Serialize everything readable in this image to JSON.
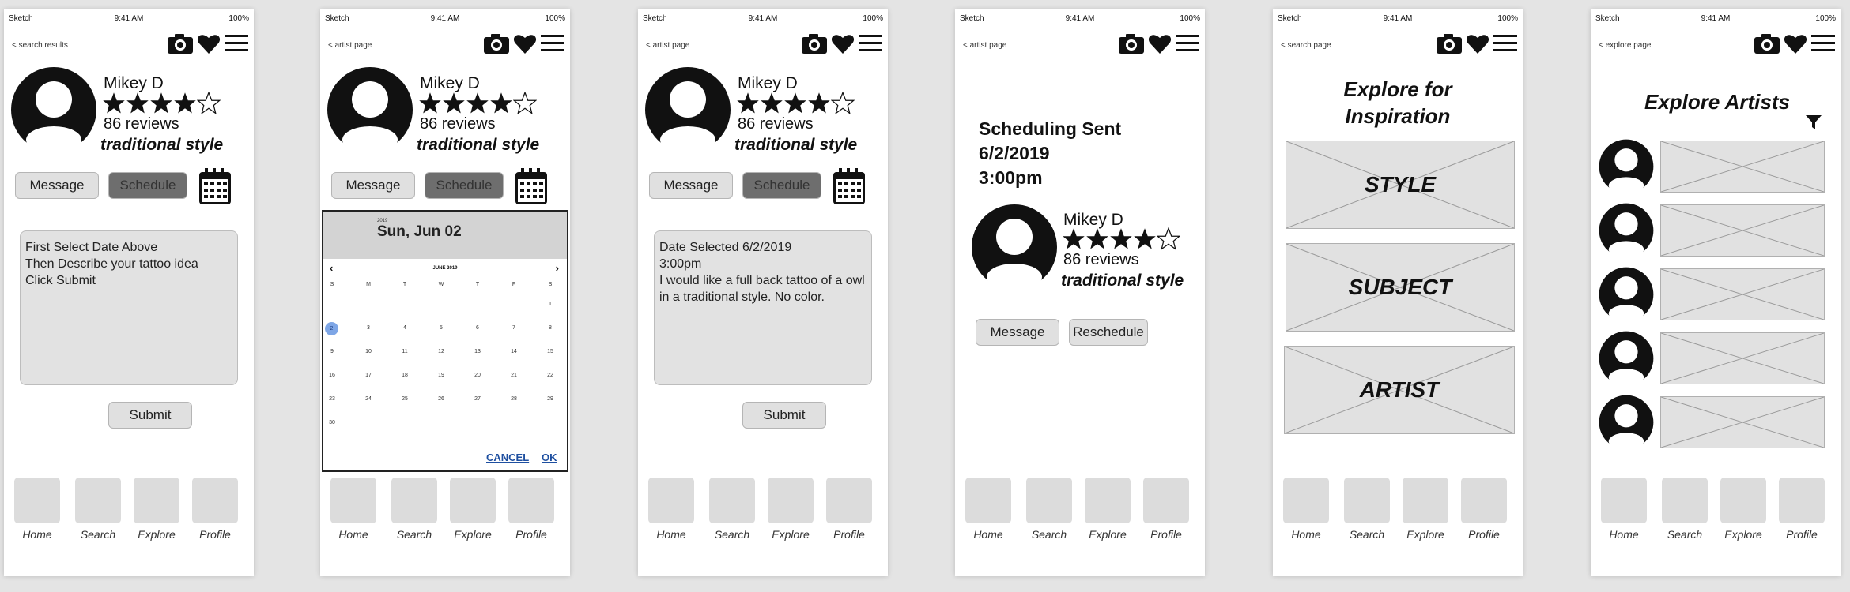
{
  "status": {
    "carrier": "Sketch",
    "time": "9:41 AM",
    "battery": "100%"
  },
  "profile": {
    "name": "Mikey D",
    "rating": 4,
    "max_rating": 5,
    "reviews": "86 reviews",
    "style": "traditional style"
  },
  "tabs": [
    "Home",
    "Search",
    "Explore",
    "Profile"
  ],
  "screen1": {
    "back": "search results",
    "message_label": "Message",
    "schedule_label": "Schedule",
    "instructions": "First Select Date Above\nThen Describe your tattoo idea\nClick Submit",
    "submit_label": "Submit"
  },
  "screen2": {
    "back": "artist page",
    "message_label": "Message",
    "schedule_label": "Schedule",
    "calendar": {
      "year": "2019",
      "selected_date": "Sun, Jun 02",
      "month_label": "JUNE 2019",
      "weekdays": [
        "S",
        "M",
        "T",
        "W",
        "T",
        "F",
        "S"
      ],
      "days": [
        "1",
        "2",
        "3",
        "4",
        "5",
        "6",
        "7",
        "8",
        "9",
        "10",
        "11",
        "12",
        "13",
        "14",
        "15",
        "16",
        "17",
        "18",
        "19",
        "20",
        "21",
        "22",
        "23",
        "24",
        "25",
        "26",
        "27",
        "28",
        "29",
        "30"
      ],
      "selected_day": "2",
      "cancel_label": "CANCEL",
      "ok_label": "OK"
    }
  },
  "screen3": {
    "back": "artist page",
    "message_label": "Message",
    "schedule_label": "Schedule",
    "request_text": "Date Selected 6/2/2019\n3:00pm\nI would like a full back tattoo of a owl in a traditional style. No color.",
    "submit_label": "Submit"
  },
  "screen4": {
    "back": "artist page",
    "title_line1": "Scheduling Sent",
    "title_line2": "6/2/2019",
    "title_line3": "3:00pm",
    "message_label": "Message",
    "reschedule_label": "Reschedule"
  },
  "screen5": {
    "back": "search page",
    "title": "Explore for Inspiration",
    "categories": [
      "STYLE",
      "SUBJECT",
      "ARTIST"
    ]
  },
  "screen6": {
    "back": "explore page",
    "title": "Explore Artists",
    "artist_count": 5
  }
}
